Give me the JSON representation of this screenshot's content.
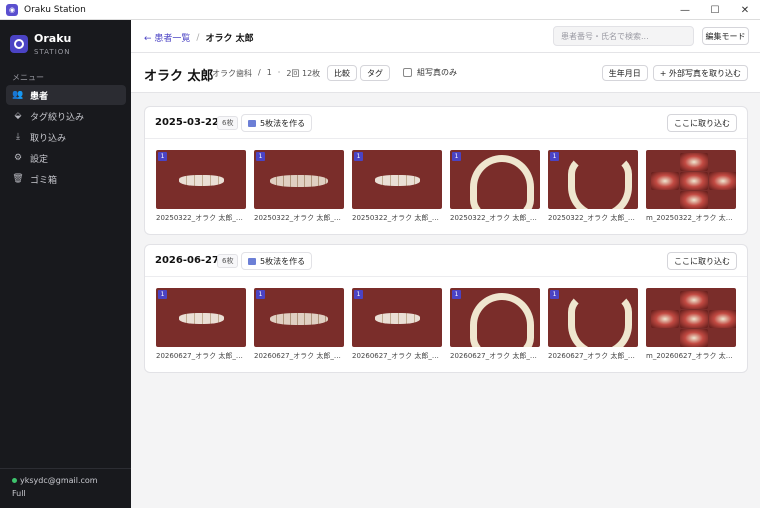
{
  "window": {
    "title": "Oraku Station",
    "controls": [
      "—",
      "☐",
      "✕"
    ]
  },
  "sidebar": {
    "brand_name": "Oraku",
    "brand_sub": "STATION",
    "menu_header": "メニュー",
    "items": [
      {
        "label": "患者",
        "icon": "patients-icon",
        "glyph": "👥",
        "active": true
      },
      {
        "label": "タグ絞り込み",
        "icon": "tag-icon",
        "glyph": "⬙",
        "active": false
      },
      {
        "label": "取り込み",
        "icon": "download-icon",
        "glyph": "⤓",
        "active": false
      },
      {
        "label": "設定",
        "icon": "settings-icon",
        "glyph": "⚙",
        "active": false
      },
      {
        "label": "ゴミ箱",
        "icon": "trash-icon",
        "glyph": "🗑",
        "active": false
      }
    ],
    "user_email": "yksydc@gmail.com",
    "plan": "Full",
    "status_color": "#3ec46d"
  },
  "topbar": {
    "back_link": "← 患者一覧",
    "separator": "/",
    "current": "オラク 太郎",
    "search_placeholder": "患者番号・氏名で検索...",
    "edit_mode_label": "編集モード"
  },
  "patient": {
    "name": "オラク 太郎",
    "clinic": "オラク歯科",
    "sep1": "/",
    "number": "1",
    "sep2": "·",
    "summary": "2回 12枚",
    "compare_label": "比較",
    "tag_label": "タグ",
    "checkbox_label": "組写真のみ",
    "birthday_label": "生年月日",
    "import_external_label": "+ 外部写真を取り込む"
  },
  "sessions": [
    {
      "date": "2025-03-22",
      "count": "6枚",
      "five_label": "5枚法を作る",
      "import_label": "ここに取り込む",
      "photos": [
        {
          "kind": "frontal",
          "badge": "1",
          "caption": "20250322_オラク 太郎_13..."
        },
        {
          "kind": "side",
          "badge": "1",
          "caption": "20250322_オラク 太郎_13..."
        },
        {
          "kind": "frontal",
          "badge": "1",
          "caption": "20250322_オラク 太郎_13..."
        },
        {
          "kind": "occl",
          "badge": "1",
          "caption": "20250322_オラク 太郎_13..."
        },
        {
          "kind": "lower",
          "badge": "1",
          "caption": "20250322_オラク 太郎_13..."
        },
        {
          "kind": "montage",
          "badge": "",
          "caption": "m_20250322_オラク 太郎_1..."
        }
      ]
    },
    {
      "date": "2026-06-27",
      "count": "6枚",
      "five_label": "5枚法を作る",
      "import_label": "ここに取り込む",
      "photos": [
        {
          "kind": "frontal",
          "badge": "1",
          "caption": "20260627_オラク 太郎_17..."
        },
        {
          "kind": "side",
          "badge": "1",
          "caption": "20260627_オラク 太郎_17..."
        },
        {
          "kind": "frontal",
          "badge": "1",
          "caption": "20260627_オラク 太郎_17..."
        },
        {
          "kind": "occl",
          "badge": "1",
          "caption": "20260627_オラク 太郎_17..."
        },
        {
          "kind": "lower",
          "badge": "1",
          "caption": "20260627_オラク 太郎_17..."
        },
        {
          "kind": "montage",
          "badge": "",
          "caption": "m_20260627_オラク 太郎_1..."
        }
      ]
    }
  ],
  "colors": {
    "accent": "#4b43c4",
    "sidebar_bg": "#18191d",
    "badge": "#4b43c4"
  }
}
